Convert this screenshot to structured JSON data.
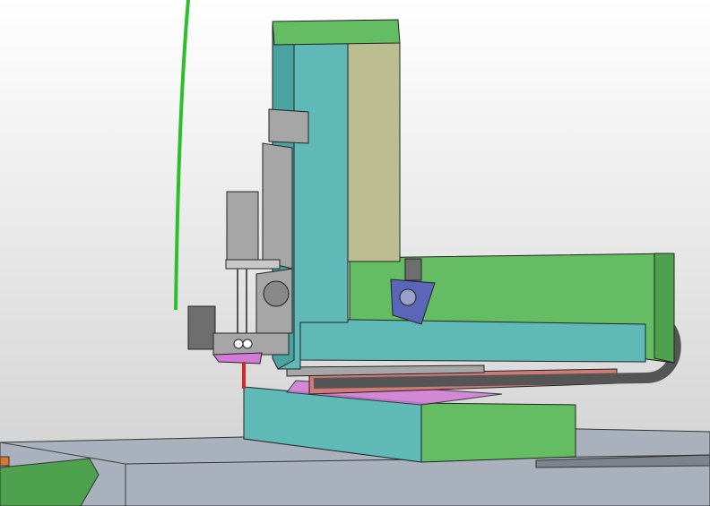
{
  "viewport": {
    "background_top": "#ffffff",
    "background_bottom": "#cfcfcf"
  },
  "colors": {
    "green": "#64bd63",
    "green_dark": "#4ea24d",
    "teal": "#5fbab7",
    "teal_dark": "#4aa3a0",
    "khaki": "#bdbd92",
    "gray_part": "#a6a6a6",
    "gray_dark": "#6e6e6e",
    "table_gray": "#a9b1bd",
    "navy_bracket": "#5b66b8",
    "salmon": "#d07a77",
    "magenta": "#d27ad6",
    "red_nozzle": "#d02a2a",
    "sketch_line": "#2bbf2b",
    "cable_chain": "#555555"
  },
  "model": {
    "parts": [
      "z-axis-column",
      "column-top-cap",
      "x-axis-beam",
      "y-axis-base",
      "cable-chain",
      "motor-mount-bracket",
      "z-carriage-plate",
      "stepper-motor",
      "print-head",
      "nozzle",
      "work-table",
      "green-sketch-line"
    ]
  }
}
